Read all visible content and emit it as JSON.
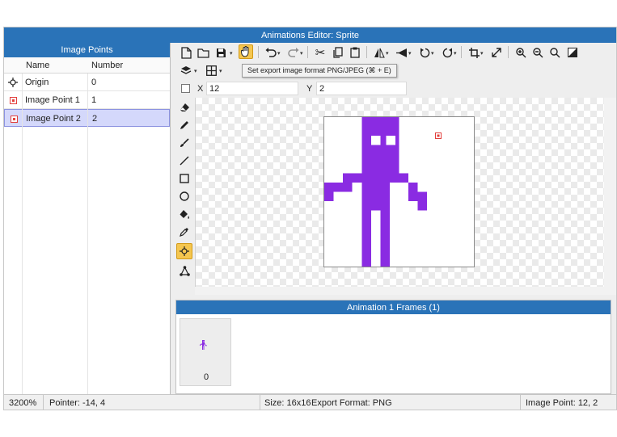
{
  "window": {
    "title": "Animations Editor: Sprite"
  },
  "image_points_panel": {
    "title": "Image Points",
    "columns": {
      "name": "Name",
      "number": "Number"
    },
    "rows": [
      {
        "name": "Origin",
        "number": "0",
        "icon": "crosshair-icon"
      },
      {
        "name": "Image Point 1",
        "number": "1",
        "icon": "image-point-icon"
      },
      {
        "name": "Image Point 2",
        "number": "2",
        "icon": "image-point-icon",
        "selected": true
      }
    ]
  },
  "toolbar": {
    "tooltip": "Set export image format PNG/JPEG (⌘ + E)",
    "icons": [
      "new-file-icon",
      "open-folder-icon",
      "save-icon",
      "export-format-icon",
      "undo-icon",
      "redo-icon",
      "cut-icon",
      "copy-icon",
      "paste-icon",
      "flip-horizontal-icon",
      "flip-vertical-icon",
      "rotate-ccw-icon",
      "rotate-cw-icon",
      "crop-icon",
      "resize-icon",
      "zoom-in-icon",
      "zoom-out-icon",
      "zoom-reset-icon",
      "toggle-background-icon",
      "layers-icon",
      "grid-icon"
    ]
  },
  "coords": {
    "x_label": "X",
    "x_value": "12",
    "y_label": "Y",
    "y_value": "2"
  },
  "tools": [
    "eraser-icon",
    "pencil-icon",
    "brush-icon",
    "line-icon",
    "rectangle-icon",
    "ellipse-icon",
    "fill-bucket-icon",
    "eyedropper-icon",
    "image-point-tool-icon",
    "mesh-icon"
  ],
  "sprite": {
    "color": "#8a2be2",
    "size": 16,
    "image_point_color": "#e2403d"
  },
  "frames_panel": {
    "title": "Animation 1 Frames (1)",
    "frames": [
      {
        "number": "0"
      }
    ]
  },
  "status": {
    "zoom": "3200%",
    "pointer": "Pointer: -14, 4",
    "size": "Size: 16x16",
    "export_format": "Export Format: PNG",
    "image_point": "Image Point: 12, 2"
  }
}
